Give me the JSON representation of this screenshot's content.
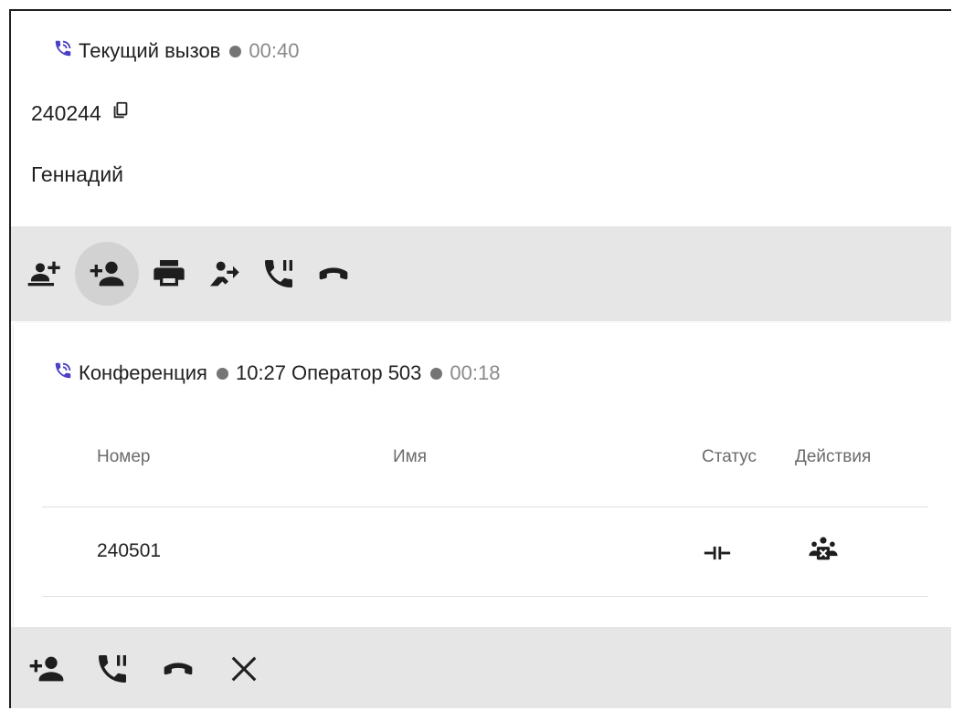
{
  "current_call": {
    "title": "Текущий вызов",
    "timer": "00:40",
    "number": "240244",
    "name": "Геннадий"
  },
  "toolbar_top": {
    "buttons": [
      "add-to-conference-icon",
      "add-user-icon",
      "print-icon",
      "transfer-icon",
      "hold-icon",
      "hangup-icon"
    ]
  },
  "conference": {
    "title": "Конференция",
    "start_time": "10:27",
    "operator": "Оператор 503",
    "timer": "00:18",
    "columns": {
      "number": "Номер",
      "name": "Имя",
      "status": "Статус",
      "actions": "Действия"
    },
    "rows": [
      {
        "number": "240501",
        "name": "",
        "status_icon": "connected-icon",
        "action_icon": "remove-participant-icon"
      }
    ]
  },
  "toolbar_bottom": {
    "buttons": [
      "add-user-icon",
      "hold-icon",
      "hangup-icon",
      "close-icon"
    ]
  },
  "colors": {
    "accent": "#4b3fc4",
    "toolbar_bg": "#e6e6e6",
    "muted": "#8a8a8a"
  }
}
